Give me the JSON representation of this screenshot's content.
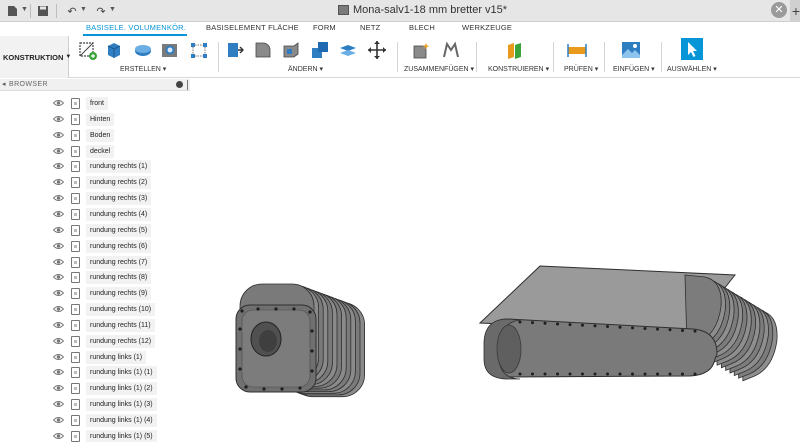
{
  "window": {
    "title": "Mona-salv1-18 mm bretter v15*"
  },
  "ribbon": {
    "tabs": [
      {
        "label": "BASISELE. VOLUMENKÖR.",
        "active": true
      },
      {
        "label": "BASISELEMENT FLÄCHE",
        "active": false
      },
      {
        "label": "FORM",
        "active": false
      },
      {
        "label": "NETZ",
        "active": false
      },
      {
        "label": "BLECH",
        "active": false
      },
      {
        "label": "WERKZEUGE",
        "active": false
      }
    ],
    "workspace": "KONSTRUKTION",
    "groups": {
      "erstellen": "ERSTELLEN",
      "aendern": "ÄNDERN",
      "zusammenfuegen": "ZUSAMMENFÜGEN",
      "konstruieren": "KONSTRUIEREN",
      "pruefen": "PRÜFEN",
      "einfuegen": "EINFÜGEN",
      "auswaehlen": "AUSWÄHLEN"
    }
  },
  "browser": {
    "title": "BROWSER",
    "items": [
      "front",
      "Hinten",
      "Boden",
      "deckel",
      "rundung rechts (1)",
      "rundung rechts (2)",
      "rundung rechts (3)",
      "rundung rechts (4)",
      "rundung rechts (5)",
      "rundung rechts (6)",
      "rundung rechts (7)",
      "rundung rechts (8)",
      "rundung rechts (9)",
      "rundung rechts (10)",
      "rundung rechts (11)",
      "rundung rechts (12)",
      "rundung links (1)",
      "rundung links (1) (1)",
      "rundung links (1) (2)",
      "rundung links (1) (3)",
      "rundung links (1) (4)",
      "rundung links (1) (5)"
    ]
  },
  "colors": {
    "accent": "#0696d7",
    "model_fill": "#7d7d7d",
    "model_top": "#9a9a9a",
    "model_edge": "#2f2f2f"
  }
}
